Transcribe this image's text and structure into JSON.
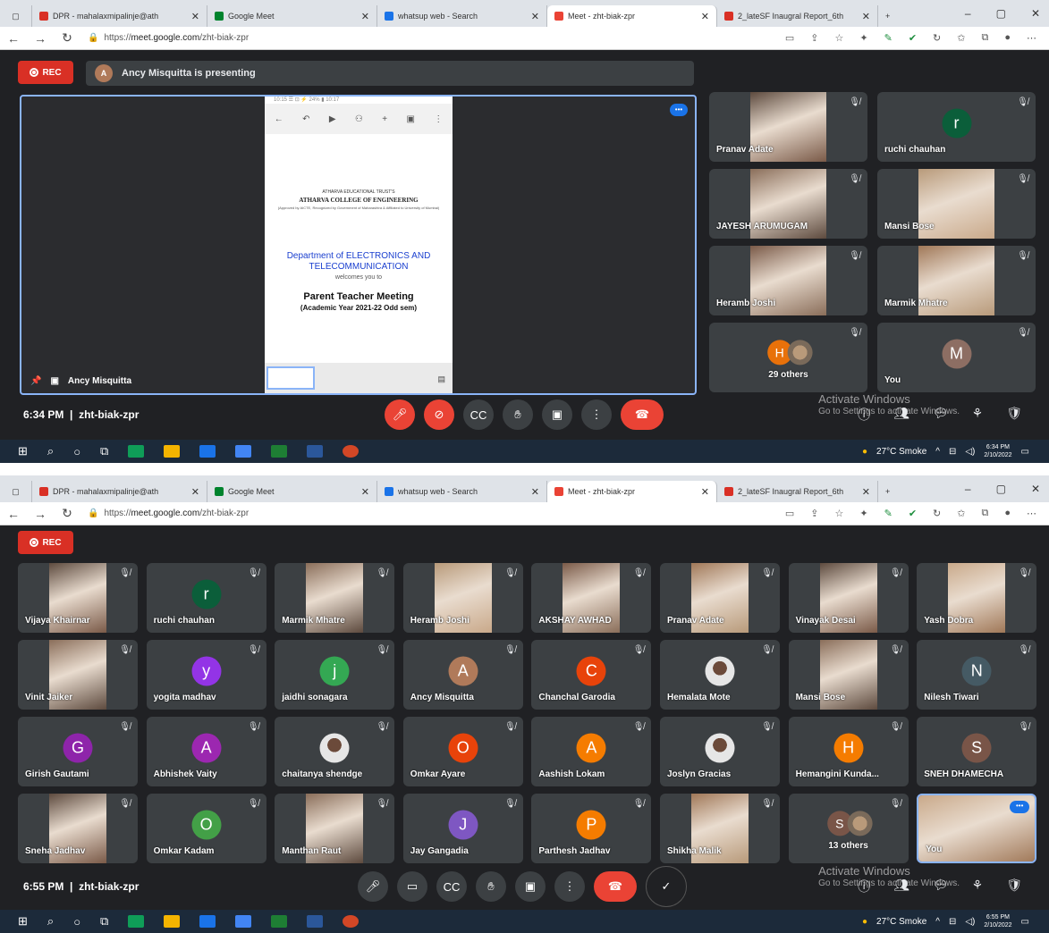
{
  "browser": {
    "tabs": [
      {
        "label": "DPR - mahalaxmipalinje@ath",
        "icon": "gmail-icon",
        "color": "#d93025"
      },
      {
        "label": "Google Meet",
        "icon": "meet-icon",
        "color": "#00832d"
      },
      {
        "label": "whatsup web - Search",
        "icon": "bing-icon",
        "color": "#1a73e8"
      },
      {
        "label": "Meet - zht-biak-zpr",
        "icon": "meet-icon",
        "color": "#ea4335"
      },
      {
        "label": "2_lateSF Inaugral Report_6th",
        "icon": "pdf-icon",
        "color": "#d93025"
      }
    ],
    "new_tab": "+",
    "url_prefix": "https://",
    "url_host": "meet.google.com",
    "url_path": "/zht-biak-zpr",
    "window_controls": [
      "–",
      "▢",
      "✕"
    ]
  },
  "shot1": {
    "rec_label": "REC",
    "presenter_initial": "A",
    "presenting_text": "Ancy Misquitta is presenting",
    "doc": {
      "status": "10:15 ☰                         ⊡ ⚡ 24% ▮ 10:17",
      "college_top": "ATHARVA EDUCATIONAL TRUST'S",
      "college": "ATHARVA COLLEGE OF ENGINEERING",
      "college_sub": "(Approved by AICTE, Recognized by Government of Maharashtra & Affiliated to University of Mumbai)",
      "dept": "Department of ELECTRONICS AND TELECOMMUNICATION",
      "welcome": "welcomes you to",
      "ptm": "Parent Teacher Meeting",
      "ay": "(Academic Year 2021-22 Odd sem)"
    },
    "presenter_name": "Ancy Misquitta",
    "tiles": [
      {
        "name": "Pranav Adate",
        "type": "video"
      },
      {
        "name": "ruchi chauhan",
        "type": "avatar",
        "initial": "r",
        "color": "#0b5e3a"
      },
      {
        "name": "JAYESH ARUMUGAM",
        "type": "video"
      },
      {
        "name": "Mansi Bose",
        "type": "video"
      },
      {
        "name": "Heramb Joshi",
        "type": "video"
      },
      {
        "name": "Marmik Mhatre",
        "type": "video"
      },
      {
        "name": "29 others",
        "type": "others",
        "initial": "H",
        "color": "#e8710a"
      },
      {
        "name": "You",
        "type": "avatar",
        "initial": "M",
        "color": "#8d6e63"
      }
    ],
    "time": "6:34 PM",
    "code": "zht-biak-zpr"
  },
  "shot2": {
    "rec_label": "REC",
    "tiles": [
      {
        "name": "Vijaya Khairnar",
        "type": "video"
      },
      {
        "name": "ruchi chauhan",
        "type": "avatar",
        "initial": "r",
        "color": "#0b5e3a"
      },
      {
        "name": "Marmik Mhatre",
        "type": "video"
      },
      {
        "name": "Heramb Joshi",
        "type": "video"
      },
      {
        "name": "AKSHAY AWHAD",
        "type": "video"
      },
      {
        "name": "Pranav Adate",
        "type": "video"
      },
      {
        "name": "Vinayak Desai",
        "type": "video"
      },
      {
        "name": "Yash Dobra",
        "type": "video"
      },
      {
        "name": "Vinit Jaiker",
        "type": "video"
      },
      {
        "name": "yogita madhav",
        "type": "avatar",
        "initial": "y",
        "color": "#9334e6"
      },
      {
        "name": "jaidhi sonagara",
        "type": "avatar",
        "initial": "j",
        "color": "#34a853"
      },
      {
        "name": "Ancy Misquitta",
        "type": "avatar",
        "initial": "A",
        "color": "#b07a5a"
      },
      {
        "name": "Chanchal Garodia",
        "type": "avatar",
        "initial": "C",
        "color": "#e8430a"
      },
      {
        "name": "Hemalata Mote",
        "type": "photo-avatar"
      },
      {
        "name": "Mansi Bose",
        "type": "video"
      },
      {
        "name": "Nilesh Tiwari",
        "type": "avatar",
        "initial": "N",
        "color": "#455a64"
      },
      {
        "name": "Girish Gautami",
        "type": "avatar",
        "initial": "G",
        "color": "#8e24aa"
      },
      {
        "name": "Abhishek Vaity",
        "type": "avatar",
        "initial": "A",
        "color": "#9c27b0"
      },
      {
        "name": "chaitanya shendge",
        "type": "photo-avatar"
      },
      {
        "name": "Omkar Ayare",
        "type": "avatar",
        "initial": "O",
        "color": "#e8430a"
      },
      {
        "name": "Aashish Lokam",
        "type": "avatar",
        "initial": "A",
        "color": "#f57c00"
      },
      {
        "name": "Joslyn Gracias",
        "type": "photo-avatar"
      },
      {
        "name": "Hemangini Kunda...",
        "type": "avatar",
        "initial": "H",
        "color": "#f57c00"
      },
      {
        "name": "SNEH DHAMECHA",
        "type": "avatar",
        "initial": "S",
        "color": "#795548"
      },
      {
        "name": "Sneha Jadhav",
        "type": "video"
      },
      {
        "name": "Omkar Kadam",
        "type": "avatar",
        "initial": "O",
        "color": "#43a047"
      },
      {
        "name": "Manthan Raut",
        "type": "video"
      },
      {
        "name": "Jay Gangadia",
        "type": "avatar",
        "initial": "J",
        "color": "#7e57c2"
      },
      {
        "name": "Parthesh Jadhav",
        "type": "avatar",
        "initial": "P",
        "color": "#f57c00"
      },
      {
        "name": "Shikha Malik",
        "type": "video"
      },
      {
        "name": "13 others",
        "type": "others",
        "initial": "S",
        "color": "#795548"
      },
      {
        "name": "You",
        "type": "you-video"
      }
    ],
    "time": "6:55 PM",
    "code": "zht-biak-zpr"
  },
  "watermark": {
    "line1": "Activate Windows",
    "line2": "Go to Settings to activate Windows."
  },
  "taskbar": {
    "weather": "27°C Smoke",
    "time1": "6:34 PM",
    "time2": "6:55 PM",
    "date": "2/10/2022"
  }
}
